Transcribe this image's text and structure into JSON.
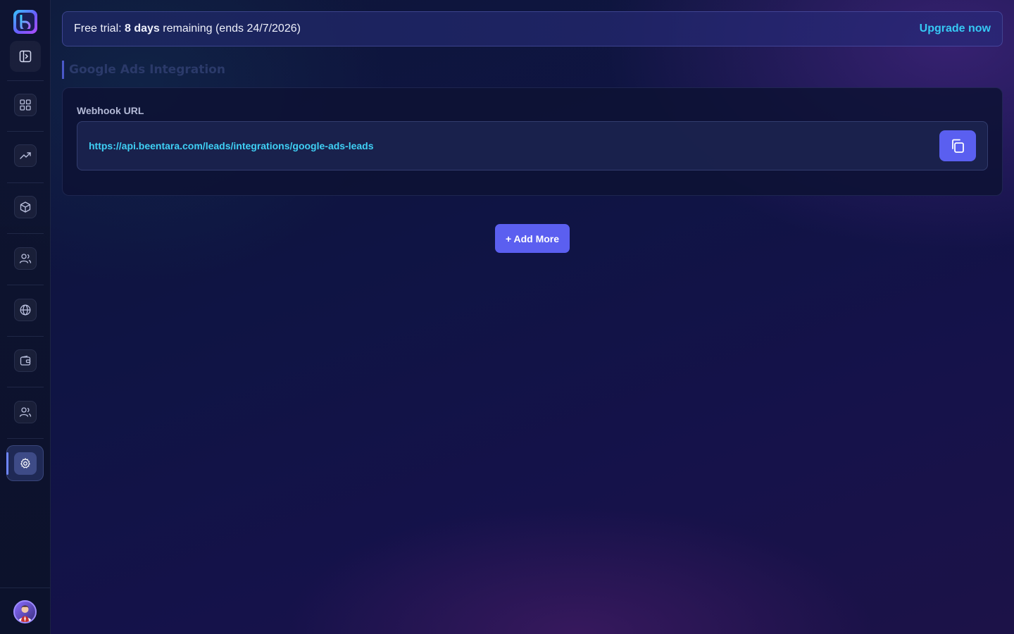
{
  "sidebar": {
    "nav_items": [
      {
        "name": "dashboard-icon"
      },
      {
        "name": "trending-icon"
      },
      {
        "name": "package-icon"
      },
      {
        "name": "users-icon"
      },
      {
        "name": "globe-icon"
      },
      {
        "name": "wallet-icon"
      },
      {
        "name": "team-icon"
      },
      {
        "name": "settings-icon",
        "active": true
      }
    ]
  },
  "banner": {
    "prefix": "Free trial: ",
    "days": "8 days",
    "suffix": " remaining (ends 24/7/2026)",
    "upgrade_label": "Upgrade now"
  },
  "section": {
    "title": "Google Ads Integration"
  },
  "webhook": {
    "label": "Webhook URL",
    "url": "https://api.beentara.com/leads/integrations/google-ads-leads"
  },
  "actions": {
    "add_more_label": "+ Add More"
  },
  "colors": {
    "accent": "#5b5ff0",
    "link": "#36c9f5",
    "url": "#3fd0f5"
  }
}
